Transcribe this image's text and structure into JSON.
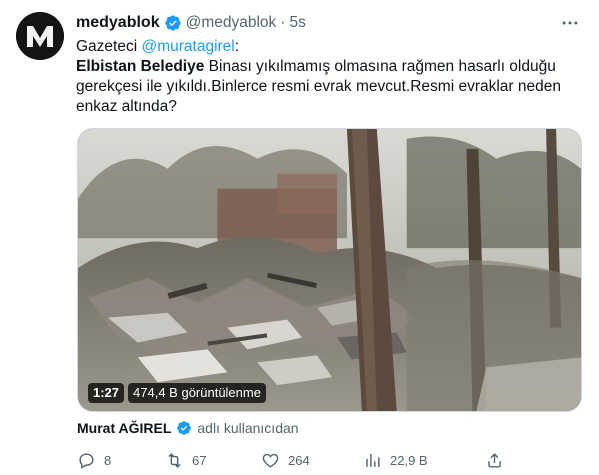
{
  "tweet": {
    "author_name": "medyablok",
    "author_handle": "@medyablok",
    "separator": "·",
    "time": "5s",
    "intro_prefix": "Gazeteci ",
    "intro_mention": "@muratagirel",
    "intro_suffix": ":",
    "text_bold": "Elbistan Belediye",
    "text_rest": " Binası yıkılmamış olmasına rağmen hasarlı olduğu gerekçesi ile yıkıldı.Binlerce resmi evrak mevcut.Resmi evraklar neden enkaz altında?"
  },
  "video": {
    "duration": "1:27",
    "views": "474,4 B görüntülenme"
  },
  "attribution": {
    "name": "Murat AĞIREL",
    "suffix": "adlı kullanıcıdan"
  },
  "actions": {
    "replies": "8",
    "retweets": "67",
    "likes": "264",
    "views": "22,9 B"
  },
  "colors": {
    "accent": "#1d9bf0",
    "text": "#0f1419",
    "secondary": "#536471"
  },
  "icons": [
    "verified-icon",
    "more-icon",
    "reply-icon",
    "retweet-icon",
    "like-icon",
    "views-icon",
    "share-icon"
  ]
}
